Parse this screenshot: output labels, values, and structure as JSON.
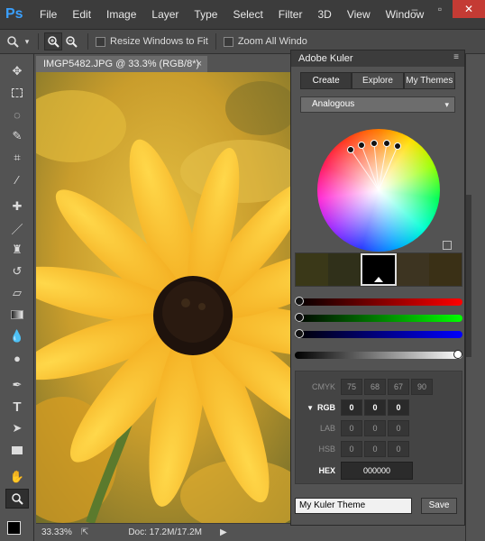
{
  "app": {
    "logo": "Ps"
  },
  "menu": [
    "File",
    "Edit",
    "Image",
    "Layer",
    "Type",
    "Select",
    "Filter",
    "3D",
    "View",
    "Window"
  ],
  "window_controls": {
    "minimize": "–",
    "maximize": "▫",
    "close": "✕"
  },
  "options_bar": {
    "resize_windows_label": "Resize Windows to Fit",
    "zoom_all_label": "Zoom All Windo"
  },
  "document": {
    "tab_title": "IMGP5482.JPG @ 33.3% (RGB/8*)",
    "close": "×"
  },
  "status": {
    "zoom": "33.33%",
    "doc": "Doc: 17.2M/17.2M"
  },
  "kuler": {
    "title": "Adobe Kuler",
    "tabs": [
      "Create",
      "Explore",
      "My Themes"
    ],
    "selected_tab": "Create",
    "rule": "Analogous",
    "swatches": [
      "#3a3818",
      "#30301a",
      "#000000",
      "#3d3421",
      "#3a3016"
    ],
    "selected_swatch_index": 2,
    "rgb_levels": {
      "red": 0,
      "green": 0,
      "blue": 0
    },
    "brightness": 1,
    "labels": {
      "cmyk": "CMYK",
      "rgb": "RGB",
      "lab": "LAB",
      "hsb": "HSB",
      "hex": "HEX"
    },
    "values": {
      "cmyk": [
        "75",
        "68",
        "67",
        "90"
      ],
      "rgb": [
        "0",
        "0",
        "0"
      ],
      "lab": [
        "0",
        "0",
        "0"
      ],
      "hsb": [
        "0",
        "0",
        "0"
      ],
      "hex": "000000"
    },
    "theme_name": "My Kuler Theme",
    "save_label": "Save"
  }
}
